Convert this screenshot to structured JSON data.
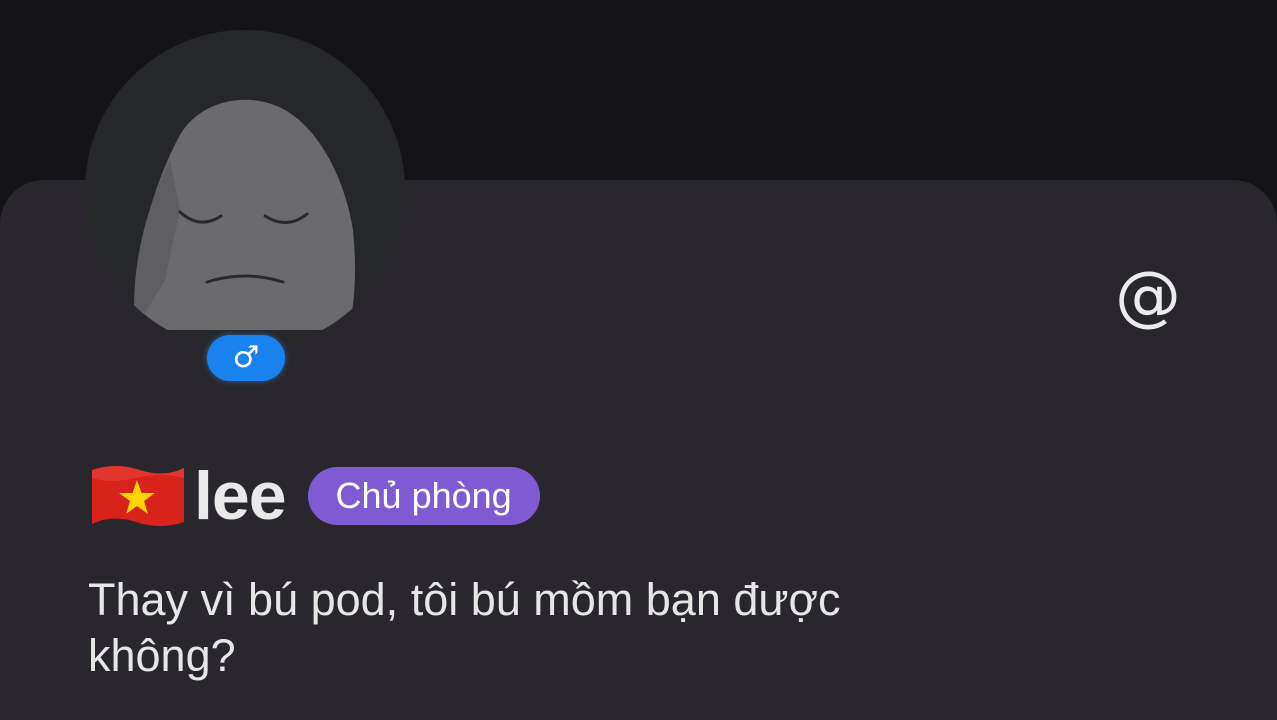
{
  "profile": {
    "avatar_icon": "default-avatar-sleeping-face",
    "gender_symbol": "♂",
    "gender_color": "#1a82ee",
    "flag_icon": "vietnam-flag",
    "username": "lee",
    "role_badge": "Chủ phòng",
    "role_badge_color": "#7e5bd2",
    "bio": "Thay vì bú pod, tôi bú mồm bạn được không?"
  },
  "actions": {
    "mention_icon": "at-sign-icon",
    "mention_symbol": "@"
  },
  "colors": {
    "background": "#141316",
    "card": "#29272d",
    "text": "#e9e9ea"
  }
}
